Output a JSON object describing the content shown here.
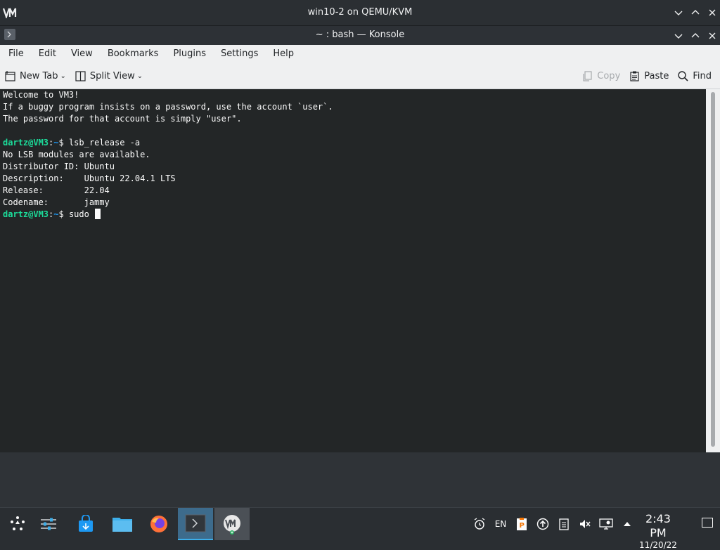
{
  "vm_window": {
    "title": "win10-2 on QEMU/KVM",
    "logo_icon": "virt-manager-logo-icon"
  },
  "konsole_window": {
    "title": "~ : bash — Konsole"
  },
  "menubar": {
    "items": [
      "File",
      "Edit",
      "View",
      "Bookmarks",
      "Plugins",
      "Settings",
      "Help"
    ]
  },
  "toolbar": {
    "new_tab": "New Tab",
    "split_view": "Split View",
    "copy": "Copy",
    "paste": "Paste",
    "find": "Find"
  },
  "terminal": {
    "lines": [
      {
        "type": "text",
        "text": "Welcome to VM3!"
      },
      {
        "type": "text",
        "text": "If a buggy program insists on a password, use the account `user`."
      },
      {
        "type": "text",
        "text": "The password for that account is simply \"user\"."
      },
      {
        "type": "text",
        "text": ""
      },
      {
        "type": "prompt",
        "user": "dartz@VM3",
        "sep": ":",
        "path": "~",
        "symbol": "$ ",
        "command": "lsb_release -a"
      },
      {
        "type": "text",
        "text": "No LSB modules are available."
      },
      {
        "type": "text",
        "text": "Distributor ID:\tUbuntu"
      },
      {
        "type": "text",
        "text": "Description:\tUbuntu 22.04.1 LTS"
      },
      {
        "type": "text",
        "text": "Release:\t22.04"
      },
      {
        "type": "text",
        "text": "Codename:\tjammy"
      },
      {
        "type": "prompt",
        "user": "dartz@VM3",
        "sep": ":",
        "path": "~",
        "symbol": "$ ",
        "command": "sudo ",
        "cursor": true
      }
    ]
  },
  "taskbar": {
    "apps": [
      {
        "name": "application-launcher-icon"
      },
      {
        "name": "system-settings-icon"
      },
      {
        "name": "discover-store-icon"
      },
      {
        "name": "dolphin-file-manager-icon"
      },
      {
        "name": "firefox-icon"
      },
      {
        "name": "konsole-icon"
      },
      {
        "name": "virt-manager-icon"
      }
    ],
    "tray": {
      "language": "EN"
    },
    "clock": {
      "time": "2:43 PM",
      "date": "11/20/22"
    }
  },
  "colors": {
    "terminal_bg": "#232627",
    "prompt_user": "#1cdc9a",
    "prompt_path": "#1d99f3",
    "accent": "#3daee9"
  }
}
